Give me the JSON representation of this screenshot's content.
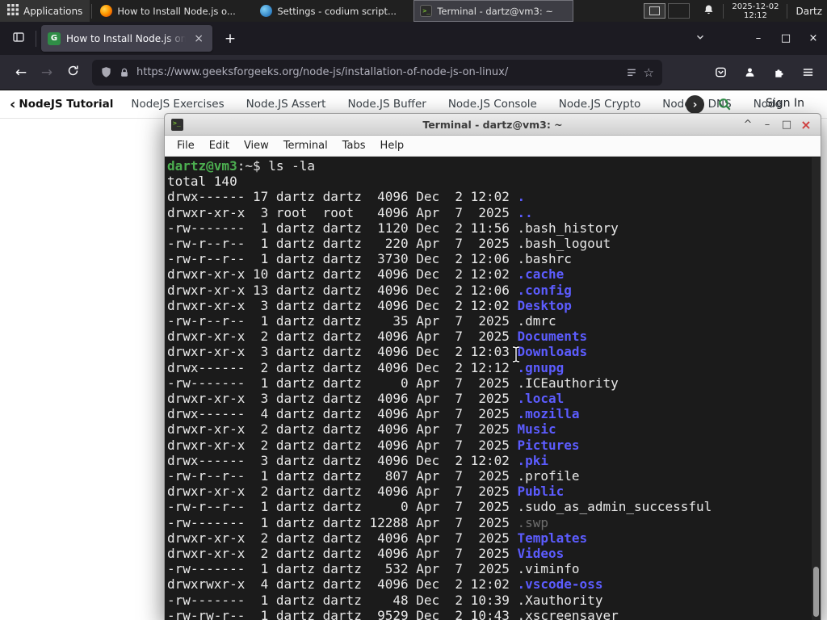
{
  "colors": {
    "gfg_green": "#2f8d46",
    "terminal_green": "#4caf50",
    "terminal_blue": "#5c5cff",
    "firefox_tab_active": "#42414d"
  },
  "panel": {
    "applications": "Applications",
    "tasks": [
      {
        "icon": "firefox",
        "label": "How to Install Node.js o...",
        "active": false
      },
      {
        "icon": "settings",
        "label": "Settings - codium script...",
        "active": false
      },
      {
        "icon": "terminal",
        "label": "Terminal - dartz@vm3: ~",
        "active": true
      }
    ],
    "date": "2025-12-02",
    "time": "12:12",
    "user": "Dartz"
  },
  "browser": {
    "tab_title": "How to Install Node.js on",
    "new_tab": "+",
    "url": "https://www.geeksforgeeks.org/node-js/installation-of-node-js-on-linux/"
  },
  "site_nav": {
    "back_chevron": "‹",
    "primary": "NodeJS Tutorial",
    "links": [
      "NodeJS Exercises",
      "Node.JS Assert",
      "Node.JS Buffer",
      "Node.JS Console",
      "Node.JS Crypto",
      "Node.JS DNS",
      "Node"
    ],
    "forward_chevron": "›",
    "sign_in": "Sign In"
  },
  "window_controls": {
    "shade": "^",
    "minimize": "–",
    "maximize": "□",
    "close": "×"
  },
  "terminal": {
    "title": "Terminal - dartz@vm3: ~",
    "menu": [
      "File",
      "Edit",
      "View",
      "Terminal",
      "Tabs",
      "Help"
    ],
    "prompt": {
      "user": "dartz@vm3",
      "rest": ":~$ "
    },
    "command": "ls -la",
    "total": "total 140",
    "listing": [
      {
        "pre": "drwx------ 17 dartz dartz  4096 Dec  2 12:02 ",
        "name": ".",
        "type": "dir"
      },
      {
        "pre": "drwxr-xr-x  3 root  root   4096 Apr  7  2025 ",
        "name": "..",
        "type": "dir"
      },
      {
        "pre": "-rw-------  1 dartz dartz  1120 Dec  2 11:56 ",
        "name": ".bash_history",
        "type": "file"
      },
      {
        "pre": "-rw-r--r--  1 dartz dartz   220 Apr  7  2025 ",
        "name": ".bash_logout",
        "type": "file"
      },
      {
        "pre": "-rw-r--r--  1 dartz dartz  3730 Dec  2 12:06 ",
        "name": ".bashrc",
        "type": "file"
      },
      {
        "pre": "drwxr-xr-x 10 dartz dartz  4096 Dec  2 12:02 ",
        "name": ".cache",
        "type": "dir"
      },
      {
        "pre": "drwxr-xr-x 13 dartz dartz  4096 Dec  2 12:06 ",
        "name": ".config",
        "type": "dir"
      },
      {
        "pre": "drwxr-xr-x  3 dartz dartz  4096 Dec  2 12:02 ",
        "name": "Desktop",
        "type": "dir"
      },
      {
        "pre": "-rw-r--r--  1 dartz dartz    35 Apr  7  2025 ",
        "name": ".dmrc",
        "type": "file"
      },
      {
        "pre": "drwxr-xr-x  2 dartz dartz  4096 Apr  7  2025 ",
        "name": "Documents",
        "type": "dir"
      },
      {
        "pre": "drwxr-xr-x  3 dartz dartz  4096 Dec  2 12:03 ",
        "name": "Downloads",
        "type": "dir"
      },
      {
        "pre": "drwx------  2 dartz dartz  4096 Dec  2 12:12 ",
        "name": ".gnupg",
        "type": "dir"
      },
      {
        "pre": "-rw-------  1 dartz dartz     0 Apr  7  2025 ",
        "name": ".ICEauthority",
        "type": "file"
      },
      {
        "pre": "drwxr-xr-x  3 dartz dartz  4096 Apr  7  2025 ",
        "name": ".local",
        "type": "dir"
      },
      {
        "pre": "drwx------  4 dartz dartz  4096 Apr  7  2025 ",
        "name": ".mozilla",
        "type": "dir"
      },
      {
        "pre": "drwxr-xr-x  2 dartz dartz  4096 Apr  7  2025 ",
        "name": "Music",
        "type": "dir"
      },
      {
        "pre": "drwxr-xr-x  2 dartz dartz  4096 Apr  7  2025 ",
        "name": "Pictures",
        "type": "dir"
      },
      {
        "pre": "drwx------  3 dartz dartz  4096 Dec  2 12:02 ",
        "name": ".pki",
        "type": "dir"
      },
      {
        "pre": "-rw-r--r--  1 dartz dartz   807 Apr  7  2025 ",
        "name": ".profile",
        "type": "file"
      },
      {
        "pre": "drwxr-xr-x  2 dartz dartz  4096 Apr  7  2025 ",
        "name": "Public",
        "type": "dir"
      },
      {
        "pre": "-rw-r--r--  1 dartz dartz     0 Apr  7  2025 ",
        "name": ".sudo_as_admin_successful",
        "type": "file"
      },
      {
        "pre": "-rw-------  1 dartz dartz 12288 Apr  7  2025 ",
        "name": ".swp",
        "type": "dim"
      },
      {
        "pre": "drwxr-xr-x  2 dartz dartz  4096 Apr  7  2025 ",
        "name": "Templates",
        "type": "dir"
      },
      {
        "pre": "drwxr-xr-x  2 dartz dartz  4096 Apr  7  2025 ",
        "name": "Videos",
        "type": "dir"
      },
      {
        "pre": "-rw-------  1 dartz dartz   532 Apr  7  2025 ",
        "name": ".viminfo",
        "type": "file"
      },
      {
        "pre": "drwxrwxr-x  4 dartz dartz  4096 Dec  2 12:02 ",
        "name": ".vscode-oss",
        "type": "dir"
      },
      {
        "pre": "-rw-------  1 dartz dartz    48 Dec  2 10:39 ",
        "name": ".Xauthority",
        "type": "file"
      },
      {
        "pre": "-rw-rw-r--  1 dartz dartz  9529 Dec  2 10:43 ",
        "name": ".xscreensaver",
        "type": "file"
      }
    ]
  }
}
